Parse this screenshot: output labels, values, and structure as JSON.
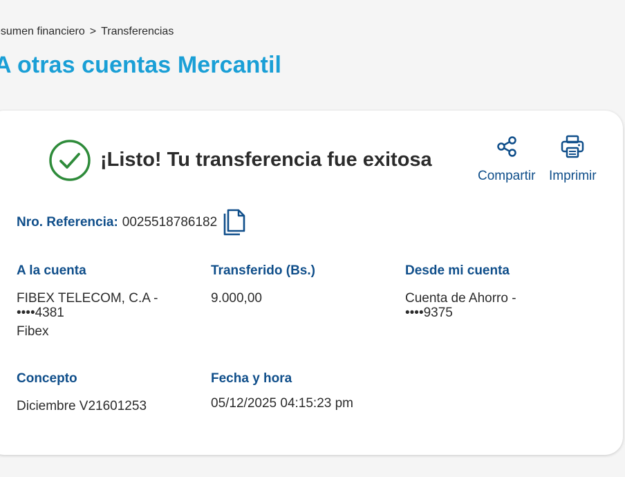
{
  "breadcrumb": {
    "items": [
      "esumen financiero",
      "Transferencias"
    ],
    "separator": ">"
  },
  "page": {
    "title": "A otras cuentas Mercantil"
  },
  "receipt": {
    "success_message": "¡Listo! Tu transferencia fue exitosa",
    "actions": {
      "share_label": "Compartir",
      "print_label": "Imprimir"
    },
    "reference": {
      "label": "Nro. Referencia:",
      "value": "0025518786182"
    },
    "to_account": {
      "label": "A la cuenta",
      "line1": "FIBEX TELECOM, C.A -",
      "line2": "••••4381",
      "line3": "Fibex"
    },
    "amount": {
      "label": "Transferido (Bs.)",
      "value": "9.000,00"
    },
    "from_account": {
      "label": "Desde mi cuenta",
      "line1": "Cuenta de Ahorro -",
      "line2": "••••9375"
    },
    "concept": {
      "label": "Concepto",
      "value": "Diciembre V21601253"
    },
    "datetime": {
      "label": "Fecha y hora",
      "value": "05/12/2025 04:15:23 pm"
    }
  },
  "colors": {
    "title_blue": "#1a9fd6",
    "label_navy": "#0f4e8a",
    "success_green": "#2e8b3a",
    "background": "#f5f5f5"
  },
  "icons": {
    "success": "check-circle-icon",
    "share": "share-icon",
    "print": "printer-icon",
    "copy": "copy-icon"
  }
}
